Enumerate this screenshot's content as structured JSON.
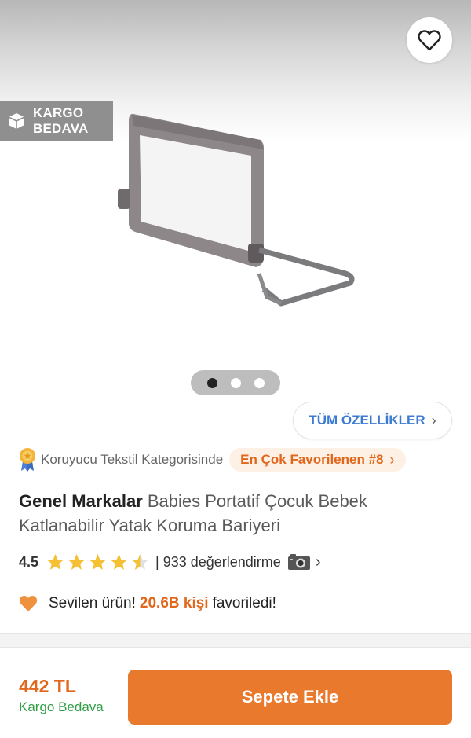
{
  "badge": {
    "line1": "KARGO",
    "line2": "BEDAVA"
  },
  "gallery": {
    "dot_count": 3,
    "active_dot": 1
  },
  "all_features": {
    "label": "TÜM ÖZELLİKLER"
  },
  "category": {
    "text": "Koruyucu Tekstil Kategorisinde",
    "rank_label": "En Çok Favorilenen #8"
  },
  "product": {
    "brand": "Genel Markalar",
    "name": "Babies Portatif Çocuk Bebek Katlanabilir Yatak Koruma Bariyeri"
  },
  "rating": {
    "value": "4.5",
    "stars": 4.5,
    "reviews": "| 933 değerlendirme"
  },
  "loved": {
    "prefix": "Sevilen ürün!",
    "count": "20.6B kişi",
    "suffix": "favoriledi!"
  },
  "footer": {
    "price": "442 TL",
    "shipping": "Kargo Bedava",
    "add_to_cart": "Sepete Ekle"
  },
  "colors": {
    "accent": "#e9792d",
    "link": "#3c7bd2",
    "success": "#2f9e44",
    "star": "#f5c034"
  },
  "icons": [
    "heart-outline-icon",
    "box-icon",
    "medal-icon",
    "star-icon",
    "camera-icon",
    "chevron-right-icon",
    "orange-heart-icon"
  ]
}
